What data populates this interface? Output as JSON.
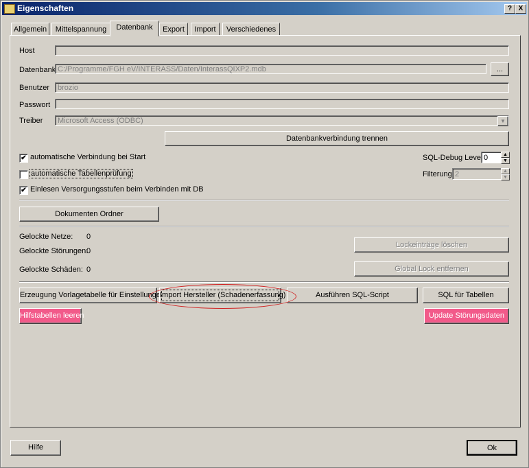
{
  "window": {
    "title": "Eigenschaften",
    "help_btn": "?",
    "close_btn": "X"
  },
  "tabs": [
    "Allgemein",
    "Mittelspannung",
    "Datenbank",
    "Export",
    "Import",
    "Verschiedenes"
  ],
  "db": {
    "host_label": "Host",
    "host_value": "",
    "datenbank_label": "Datenbank",
    "datenbank_value": "C:/Programme/FGH eV/INTERASS/Daten/InterassQIXP2.mdb",
    "browse_btn": "...",
    "benutzer_label": "Benutzer",
    "benutzer_value": "brozio",
    "passwort_label": "Passwort",
    "passwort_value": "",
    "treiber_label": "Treiber",
    "treiber_value": "Microsoft Access (ODBC)",
    "disconnect_btn": "Datenbankverbindung trennen"
  },
  "options": {
    "auto_connect": "automatische Verbindung bei Start",
    "auto_table_check": "automatische Tabellenprüfung",
    "read_levels": "Einlesen Versorgungsstufen beim Verbinden mit DB",
    "auto_connect_checked": "✔",
    "read_levels_checked": "✔",
    "sql_debug_label": "SQL-Debug Level",
    "sql_debug_value": "0",
    "filtering_label": "Filterung",
    "filtering_value": "2"
  },
  "docs_btn": "Dokumenten Ordner",
  "locks": {
    "netze_label": "Gelockte Netze:",
    "netze_value": "0",
    "stoerungen_label": "Gelockte Störungen:",
    "stoerungen_value": "0",
    "schaeden_label": "Gelockte Schäden:",
    "schaeden_value": "0",
    "delete_btn": "Lockeinträge löschen",
    "remove_global_btn": "Global Lock entfernen"
  },
  "actions": {
    "vorlage_btn": "Erzeugung Vorlagetabelle für Einstellungen",
    "import_btn": "Import Hersteller (Schadenerfassung)",
    "sql_script_btn": "Ausführen SQL-Script",
    "sql_tables_btn": "SQL für Tabellen",
    "hilfstabellen_btn": "Hilfstabellen leeren",
    "update_btn": "Update Störungsdaten"
  },
  "footer": {
    "hilfe_btn": "Hilfe",
    "ok_btn": "Ok"
  },
  "colors": {
    "pink_button": "#f25a8a",
    "title_gradient_start": "#0a246a",
    "highlight_oval": "#d02020"
  }
}
